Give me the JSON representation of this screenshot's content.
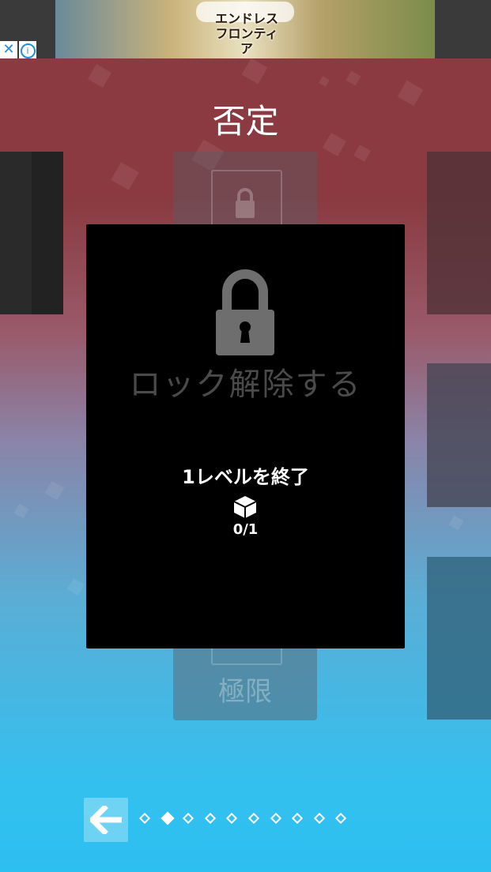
{
  "ad": {
    "logo_text_line1": "エンドレス",
    "logo_text_line2": "フロンティア",
    "close_icon": "close-icon",
    "info_icon": "info-icon"
  },
  "header": {
    "title": "否定"
  },
  "level_card": {
    "label": "極限",
    "lock_icon": "lock-icon"
  },
  "modal": {
    "title": "ロック解除する",
    "requirement": "1レベルを終了",
    "progress": "0/1",
    "lock_icon": "lock-icon",
    "cube_icon": "cube-icon"
  },
  "footer": {
    "back_icon": "arrow-left-icon",
    "page_count": 10,
    "active_page": 2
  },
  "colors": {
    "top_bg": "#8a3a40",
    "bottom_bg": "#2dbff0",
    "modal_bg": "#000000",
    "lock_gray": "#6e6e6e"
  }
}
